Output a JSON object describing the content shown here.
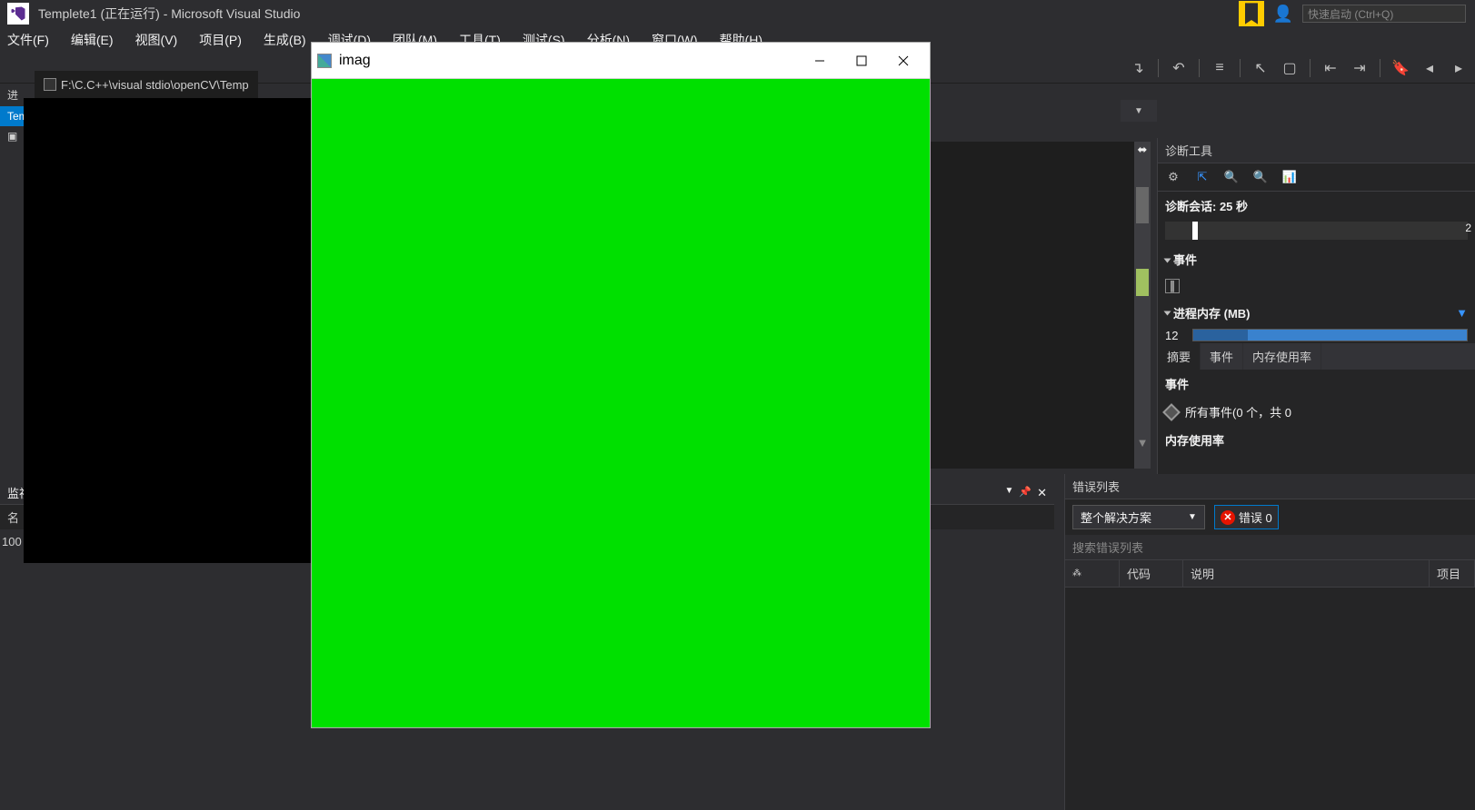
{
  "title_bar": {
    "title": "Templete1 (正在运行) - Microsoft Visual Studio",
    "quick_launch": "快速启动 (Ctrl+Q)"
  },
  "menu": {
    "file": "文件(F)",
    "edit": "编辑(E)",
    "view": "视图(V)",
    "project": "项目(P)",
    "build": "生成(B)",
    "debug": "调试(D)",
    "team": "团队(M)",
    "tools": "工具(T)",
    "test": "测试(S)",
    "analyze": "分析(N)",
    "window": "窗口(W)",
    "help": "帮助(H)"
  },
  "console": {
    "tab_path": "F:\\C.C++\\visual stdio\\openCV\\Temp"
  },
  "left_strip": {
    "process_label": "进",
    "temp_label": "Tem",
    "percent": "100"
  },
  "watch": {
    "label": "监视",
    "col_name": "名"
  },
  "diag": {
    "title": "诊断工具",
    "session": "诊断会话: 25 秒",
    "timeline_right": "2",
    "events": "事件",
    "process_mem": "进程内存 (MB)",
    "mem_val": "12",
    "tab_summary": "摘要",
    "tab_events": "事件",
    "tab_mem": "内存使用率",
    "events_header": "事件",
    "all_events": "所有事件(0 个，共 0",
    "mem_usage": "内存使用率"
  },
  "error_list": {
    "title": "错误列表",
    "scope": "整个解决方案",
    "errors": "错误 0",
    "search": "搜索错误列表",
    "col_code": "代码",
    "col_desc": "说明",
    "col_proj": "项目"
  },
  "img_window": {
    "title": "imag"
  }
}
